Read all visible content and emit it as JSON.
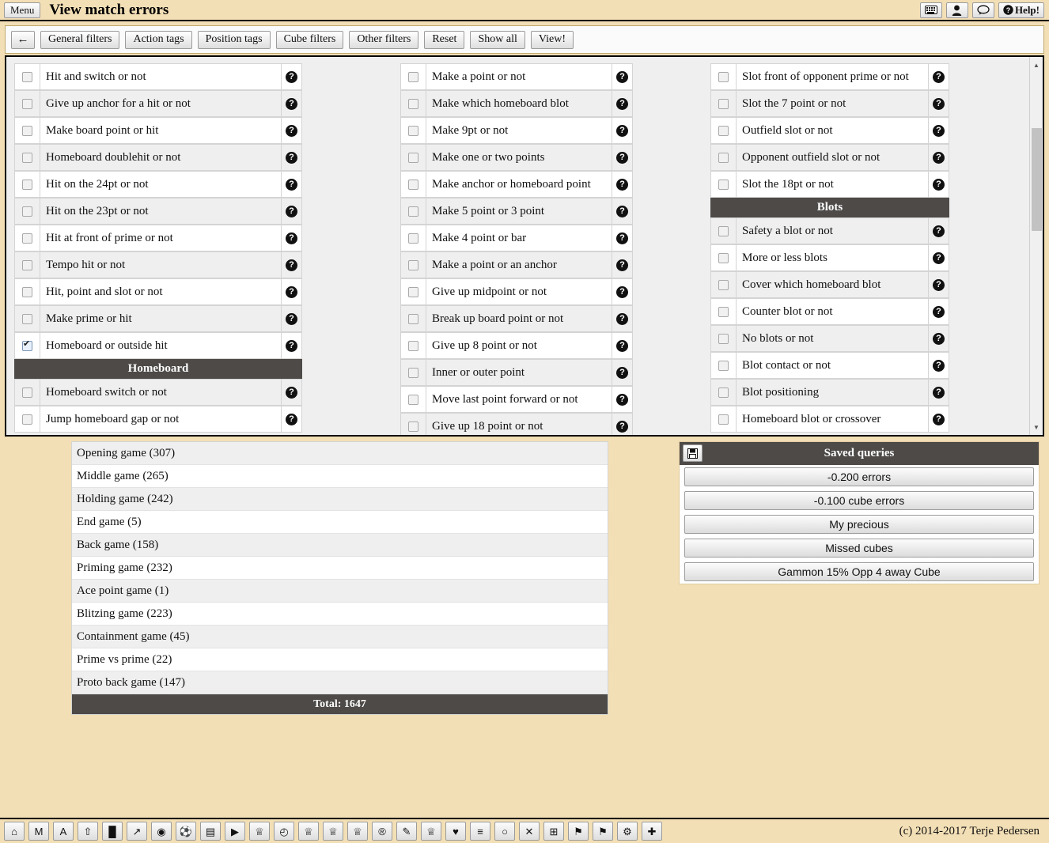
{
  "titlebar": {
    "menu_label": "Menu",
    "title": "View match errors",
    "icons": [
      {
        "name": "keyboard-icon",
        "glyph": "⌨"
      },
      {
        "name": "user-icon",
        "glyph": "♟"
      },
      {
        "name": "comment-icon",
        "glyph": "○"
      },
      {
        "name": "help-icon",
        "glyph": "?",
        "label": "Help!"
      }
    ]
  },
  "filterbar": {
    "back_label": "←",
    "buttons": [
      "General filters",
      "Action tags",
      "Position tags",
      "Cube filters",
      "Other filters",
      "Reset",
      "Show all",
      "View!"
    ]
  },
  "columns": [
    {
      "name": "column-1",
      "rows": [
        {
          "type": "option",
          "label": "Hit and switch or not",
          "checked": false
        },
        {
          "type": "option",
          "label": "Give up anchor for a hit or not",
          "checked": false
        },
        {
          "type": "option",
          "label": "Make board point or hit",
          "checked": false
        },
        {
          "type": "option",
          "label": "Homeboard doublehit or not",
          "checked": false
        },
        {
          "type": "option",
          "label": "Hit on the 24pt or not",
          "checked": false
        },
        {
          "type": "option",
          "label": "Hit on the 23pt or not",
          "checked": false
        },
        {
          "type": "option",
          "label": "Hit at front of prime or not",
          "checked": false
        },
        {
          "type": "option",
          "label": "Tempo hit or not",
          "checked": false
        },
        {
          "type": "option",
          "label": "Hit, point and slot or not",
          "checked": false
        },
        {
          "type": "option",
          "label": "Make prime or hit",
          "checked": false
        },
        {
          "type": "option",
          "label": "Homeboard or outside hit",
          "checked": true
        },
        {
          "type": "header",
          "label": "Homeboard"
        },
        {
          "type": "option",
          "label": "Homeboard switch or not",
          "checked": false
        },
        {
          "type": "option",
          "label": "Jump homeboard gap or not",
          "checked": false
        }
      ]
    },
    {
      "name": "column-2",
      "rows": [
        {
          "type": "option",
          "label": "Make a point or not",
          "checked": false
        },
        {
          "type": "option",
          "label": "Make which homeboard blot",
          "checked": false
        },
        {
          "type": "option",
          "label": "Make 9pt or not",
          "checked": false
        },
        {
          "type": "option",
          "label": "Make one or two points",
          "checked": false
        },
        {
          "type": "option",
          "label": "Make anchor or homeboard point",
          "checked": false
        },
        {
          "type": "option",
          "label": "Make 5 point or 3 point",
          "checked": false
        },
        {
          "type": "option",
          "label": "Make 4 point or bar",
          "checked": false
        },
        {
          "type": "option",
          "label": "Make a point or an anchor",
          "checked": false
        },
        {
          "type": "option",
          "label": "Give up midpoint or not",
          "checked": false
        },
        {
          "type": "option",
          "label": "Break up board point or not",
          "checked": false
        },
        {
          "type": "option",
          "label": "Give up 8 point or not",
          "checked": false
        },
        {
          "type": "option",
          "label": "Inner or outer point",
          "checked": false
        },
        {
          "type": "option",
          "label": "Move last point forward or not",
          "checked": false
        },
        {
          "type": "option",
          "label": "Give up 18 point or not",
          "checked": false
        }
      ]
    },
    {
      "name": "column-3",
      "rows": [
        {
          "type": "option",
          "label": "Slot front of opponent prime or not",
          "checked": false
        },
        {
          "type": "option",
          "label": "Slot the 7 point or not",
          "checked": false
        },
        {
          "type": "option",
          "label": "Outfield slot or not",
          "checked": false
        },
        {
          "type": "option",
          "label": "Opponent outfield slot or not",
          "checked": false
        },
        {
          "type": "option",
          "label": "Slot the 18pt or not",
          "checked": false
        },
        {
          "type": "header",
          "label": "Blots"
        },
        {
          "type": "option",
          "label": "Safety a blot or not",
          "checked": false
        },
        {
          "type": "option",
          "label": "More or less blots",
          "checked": false
        },
        {
          "type": "option",
          "label": "Cover which homeboard blot",
          "checked": false
        },
        {
          "type": "option",
          "label": "Counter blot or not",
          "checked": false
        },
        {
          "type": "option",
          "label": "No blots or not",
          "checked": false
        },
        {
          "type": "option",
          "label": "Blot contact or not",
          "checked": false
        },
        {
          "type": "option",
          "label": "Blot positioning",
          "checked": false
        },
        {
          "type": "option",
          "label": "Homeboard blot or crossover",
          "checked": false
        }
      ]
    }
  ],
  "help_glyph": "?",
  "gamelist": {
    "rows": [
      "Opening game (307)",
      "Middle game (265)",
      "Holding game (242)",
      "End game (5)",
      "Back game (158)",
      "Priming game (232)",
      "Ace point game (1)",
      "Blitzing game (223)",
      "Containment game (45)",
      "Prime vs prime (22)",
      "Proto back game (147)"
    ],
    "total_label": "Total: 1647"
  },
  "saved_queries": {
    "header": "Saved queries",
    "save_icon": "💾",
    "items": [
      "-0.200 errors",
      "-0.100 cube errors",
      "My precious",
      "Missed cubes",
      "Gammon 15% Opp 4 away Cube"
    ]
  },
  "bottombar": {
    "icons": [
      {
        "name": "home-icon",
        "glyph": "⌂"
      },
      {
        "name": "match-icon",
        "glyph": "M"
      },
      {
        "name": "analysis-icon",
        "glyph": "A"
      },
      {
        "name": "upload-icon",
        "glyph": "⇧"
      },
      {
        "name": "bar-chart-icon",
        "glyph": "█"
      },
      {
        "name": "line-chart-icon",
        "glyph": "↗"
      },
      {
        "name": "eye-icon",
        "glyph": "◉"
      },
      {
        "name": "ball-icon",
        "glyph": "⚽"
      },
      {
        "name": "archive-icon",
        "glyph": "▤"
      },
      {
        "name": "play-icon",
        "glyph": "▶"
      },
      {
        "name": "trophy-icon",
        "glyph": "♕"
      },
      {
        "name": "clock-icon",
        "glyph": "◴"
      },
      {
        "name": "trophy-2-icon",
        "glyph": "♕"
      },
      {
        "name": "trophy-3-icon",
        "glyph": "♕"
      },
      {
        "name": "trophy-4-icon",
        "glyph": "♕"
      },
      {
        "name": "registered-icon",
        "glyph": "®"
      },
      {
        "name": "edit-icon",
        "glyph": "✎"
      },
      {
        "name": "trophy-5-icon",
        "glyph": "♕"
      },
      {
        "name": "heart-icon",
        "glyph": "♥"
      },
      {
        "name": "database-icon",
        "glyph": "≡"
      },
      {
        "name": "comment-icon",
        "glyph": "○"
      },
      {
        "name": "close-icon",
        "glyph": "✕"
      },
      {
        "name": "film-icon",
        "glyph": "⊞"
      },
      {
        "name": "bookmark-icon",
        "glyph": "⚑"
      },
      {
        "name": "bookmark-2-icon",
        "glyph": "⚑"
      },
      {
        "name": "settings-icon",
        "glyph": "⚙"
      },
      {
        "name": "add-icon",
        "glyph": "✚"
      }
    ],
    "copyright": "(c) 2014-2017 Terje Pedersen"
  }
}
